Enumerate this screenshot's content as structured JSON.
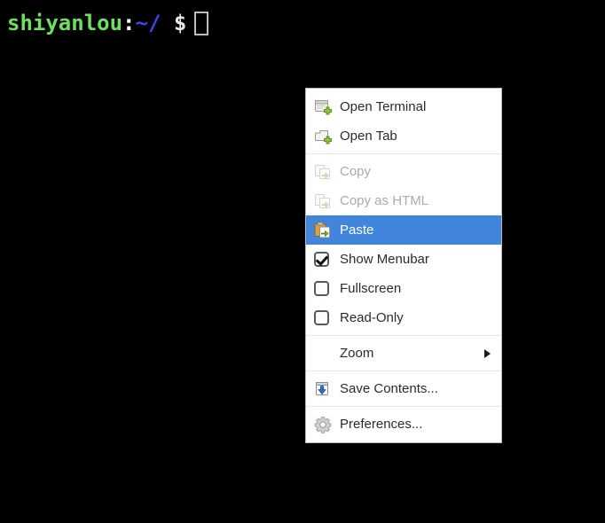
{
  "terminal": {
    "prompt": {
      "user": "shiyanlou",
      "colon": ":",
      "path": "~/",
      "dollar": "$"
    },
    "cursor_icon": "block-cursor",
    "background_color": "#000000",
    "user_color": "#6fdf5f",
    "path_color": "#3b46ec"
  },
  "context_menu": {
    "highlight_color": "#4285dc",
    "background_color": "#ffffff",
    "items": [
      {
        "label": "Open Terminal",
        "icon": "new-terminal-icon",
        "type": "command",
        "state": "enabled"
      },
      {
        "label": "Open Tab",
        "icon": "new-tab-icon",
        "type": "command",
        "state": "enabled"
      },
      {
        "label": "Copy",
        "icon": "copy-icon",
        "type": "command",
        "state": "disabled"
      },
      {
        "label": "Copy as HTML",
        "icon": "copy-html-icon",
        "type": "command",
        "state": "disabled"
      },
      {
        "label": "Paste",
        "icon": "paste-icon",
        "type": "command",
        "state": "selected"
      },
      {
        "label": "Show Menubar",
        "icon": "checkbox-checked",
        "type": "checkbox",
        "state": "checked"
      },
      {
        "label": "Fullscreen",
        "icon": "checkbox-unchecked",
        "type": "checkbox",
        "state": "unchecked"
      },
      {
        "label": "Read-Only",
        "icon": "checkbox-unchecked",
        "type": "checkbox",
        "state": "unchecked"
      },
      {
        "label": "Zoom",
        "icon": "submenu-arrow-icon",
        "type": "submenu",
        "state": "enabled"
      },
      {
        "label": "Save Contents...",
        "icon": "save-icon",
        "type": "command",
        "state": "enabled"
      },
      {
        "label": "Preferences...",
        "icon": "gear-icon",
        "type": "command",
        "state": "enabled"
      }
    ]
  }
}
